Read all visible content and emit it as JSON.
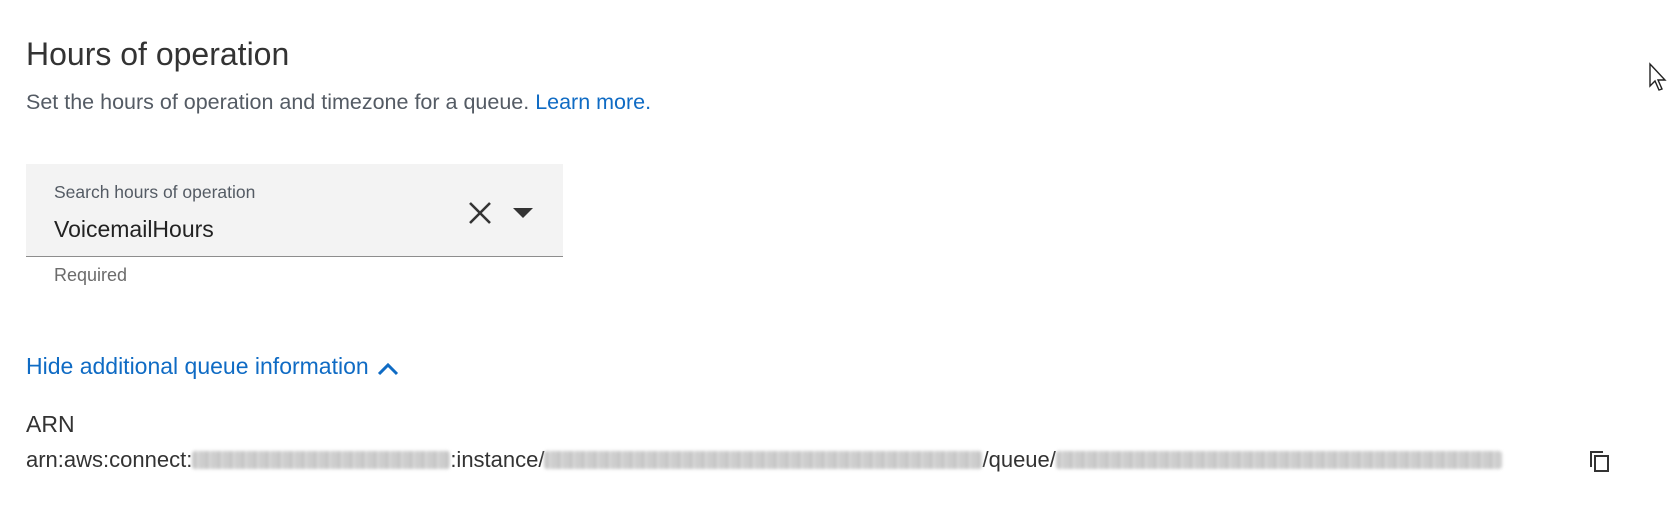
{
  "section": {
    "title": "Hours of operation",
    "description": "Set the hours of operation and timezone for a queue.",
    "learn_more": "Learn more."
  },
  "search": {
    "label": "Search hours of operation",
    "value": "VoicemailHours",
    "helper": "Required",
    "clear_icon": "close-icon",
    "dropdown_icon": "caret-down-icon"
  },
  "additional": {
    "toggle_label": "Hide additional queue information",
    "toggle_icon": "chevron-up-icon",
    "arn_label": "ARN",
    "arn_parts": {
      "prefix": "arn:aws:connect:",
      "instance": ":instance/",
      "queue": "/queue/"
    },
    "copy_icon": "copy-icon"
  },
  "colors": {
    "link": "#0f6bc4",
    "field_bg": "#f3f3f3",
    "text": "#333333"
  }
}
